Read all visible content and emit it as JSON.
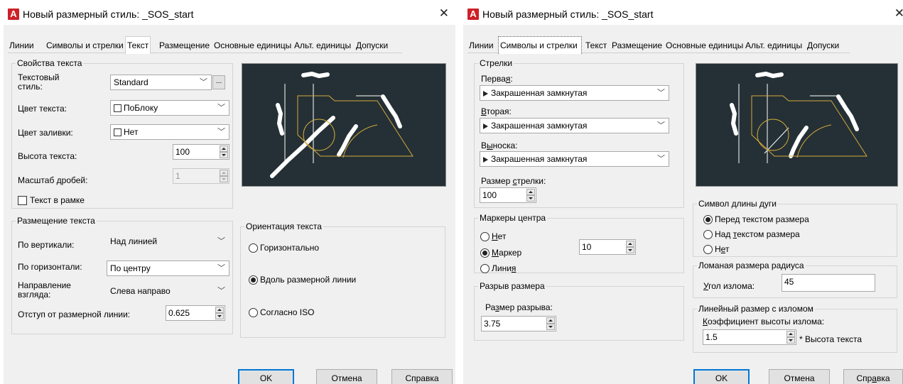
{
  "dialog1": {
    "title": "Новый размерный стиль: _SOS_start",
    "app_icon_letter": "A",
    "tabs": [
      {
        "label": "Линии"
      },
      {
        "label": "Символы и стрелки"
      },
      {
        "label": "Текст",
        "active": true
      },
      {
        "label": "Размещение"
      },
      {
        "label": "Основные единицы"
      },
      {
        "label": "Альт. единицы"
      },
      {
        "label": "Допуски"
      }
    ],
    "text_props": {
      "title": "Свойства текста",
      "style_label_1": "Текстовый",
      "style_label_2": "стиль:",
      "style_value": "Standard",
      "style_btn": "...",
      "color_label": "Цвет текста:",
      "color_value": "ПоБлоку",
      "fill_label": "Цвет заливки:",
      "fill_value": "Нет",
      "height_label": "Высота текста:",
      "height_value": "100",
      "fraction_label": "Масштаб дробей:",
      "fraction_value": "1",
      "frame_label": "Текст в рамке"
    },
    "placement": {
      "title": "Размещение текста",
      "vertical_label": "По вертикали:",
      "vertical_value": "Над линией",
      "horizontal_label": "По горизонтали:",
      "horizontal_value": "По центру",
      "view_label_1": "Направление",
      "view_label_2": "взгляда:",
      "view_value": "Слева направо",
      "offset_label": "Отступ от размерной линии:",
      "offset_value": "0.625"
    },
    "orientation": {
      "title": "Ориентация текста",
      "options": [
        {
          "label": "Горизонтально",
          "selected": false
        },
        {
          "label": "Вдоль размерной линии",
          "selected": true
        },
        {
          "label": "Согласно ISO",
          "selected": false
        }
      ]
    },
    "buttons": {
      "ok": "OK",
      "cancel": "Отмена",
      "help": "Справка"
    }
  },
  "dialog2": {
    "title": "Новый размерный стиль: _SOS_start",
    "app_icon_letter": "A",
    "tabs": [
      {
        "label": "Линии"
      },
      {
        "label": "Символы и стрелки",
        "active": true
      },
      {
        "label": "Текст"
      },
      {
        "label": "Размещение"
      },
      {
        "label": "Основные единицы"
      },
      {
        "label": "Альт. единицы"
      },
      {
        "label": "Допуски"
      }
    ],
    "arrows": {
      "title": "Стрелки",
      "first_label_pre": "Перва",
      "first_label_u": "я",
      "first_label_post": ":",
      "first_value": "Закрашенная замкнутая",
      "second_label_u": "В",
      "second_label_post": "торая:",
      "second_value": "Закрашенная замкнутая",
      "leader_label_pre": "В",
      "leader_label_u": "ы",
      "leader_label_post": "носка:",
      "leader_value": "Закрашенная замкнутая",
      "size_label_pre": "Размер ",
      "size_label_u": "с",
      "size_label_post": "трелки:",
      "size_value": "100"
    },
    "center_marks": {
      "title": "Маркеры центра",
      "none_u": "Н",
      "none_post": "ет",
      "mark_u": "М",
      "mark_post": "аркер",
      "line_pre": "Лини",
      "line_u": "я",
      "mark_value": "10",
      "selected": "mark"
    },
    "break": {
      "title": "Разрыв размера",
      "size_label_pre": "Ра",
      "size_label_u": "з",
      "size_label_post": "мер разрыва:",
      "size_value": "3.75"
    },
    "arc_length": {
      "title": "Символ длины дуги",
      "before_pre": "Перед",
      "before_u": "",
      "before_post": " текстом размера",
      "above_pre": "Над ",
      "above_u": "т",
      "above_post": "екстом размера",
      "none_pre": "Н",
      "none_u": "е",
      "none_post": "т",
      "selected": "before"
    },
    "radius_jog": {
      "title": "Ломаная размера радиуса",
      "angle_label_u": "У",
      "angle_label_post": "гол излома:",
      "angle_value": "45"
    },
    "linear_jog": {
      "title": "Линейный размер с изломом",
      "factor_label_u": "К",
      "factor_label_post": "оэффициент высоты излома:",
      "factor_value": "1.5",
      "factor_suffix": "* Высота текста"
    },
    "buttons": {
      "ok": "OK",
      "cancel": "Отмена",
      "help_pre": "Спр",
      "help_u": "а",
      "help_post": "вка"
    }
  }
}
